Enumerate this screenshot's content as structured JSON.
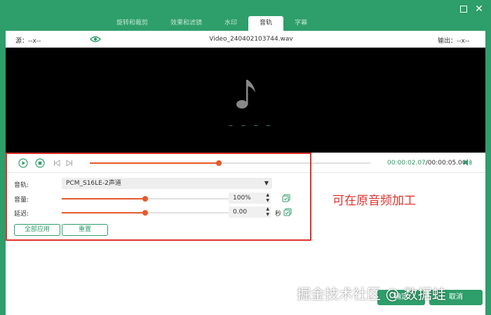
{
  "tabs": [
    {
      "label": "旋转和裁剪",
      "active": false
    },
    {
      "label": "效果和滤镜",
      "active": false
    },
    {
      "label": "水印",
      "active": false
    },
    {
      "label": "音轨",
      "active": true
    },
    {
      "label": "字幕",
      "active": false
    }
  ],
  "info": {
    "source_label": "源：--x--",
    "filename": "Video_240402103744.wav",
    "output_label": "输出：--x--"
  },
  "playback": {
    "current_time": "00:00:02.07",
    "total_time": "/00:00:05.00",
    "progress": 0.46
  },
  "audio": {
    "track_label": "音轨:",
    "track_value": "PCM_S16LE-2声道",
    "volume_label": "音量:",
    "volume_value": "100%",
    "volume_level": 0.5,
    "delay_label": "延迟:",
    "delay_value": "0.00",
    "delay_level": 0.5,
    "delay_unit": "秒"
  },
  "buttons": {
    "apply_all": "全部应用",
    "reset": "重置",
    "ok": "确定",
    "cancel": "取消"
  },
  "annotation": "可在原音频加工",
  "watermark": "掘金技术社区 @ 数据蛙",
  "colors": {
    "brand_green": "#2e9e6a",
    "accent_orange": "#e65a2a",
    "annotation_red": "#e0322d"
  }
}
